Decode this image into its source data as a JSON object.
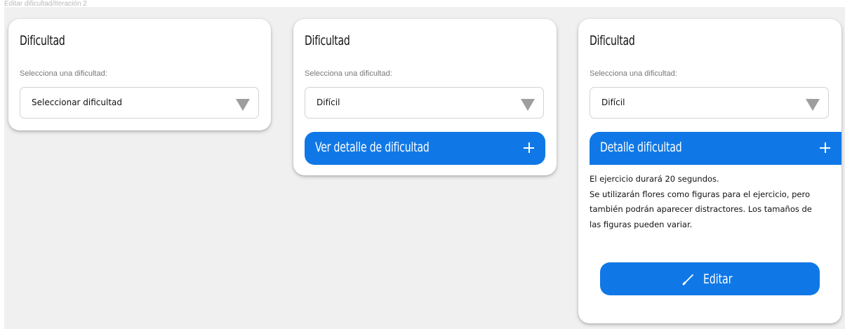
{
  "breadcrumb": "Editar dificultad/Iteración 2",
  "colors": {
    "accent": "#1078e6",
    "background": "#f0f0f0",
    "card": "#ffffff"
  },
  "panels": [
    {
      "title": "Dificultad",
      "select_label": "Selecciona una dificultad:",
      "select_value": "Seleccionar dificultad",
      "arrow_icon": "triangle-down-icon"
    },
    {
      "title": "Dificultad",
      "select_label": "Selecciona una dificultad:",
      "select_value": "Difícil",
      "arrow_icon": "triangle-down-icon",
      "button_label": "Ver detalle de dificultad",
      "button_icon": "plus-icon"
    },
    {
      "title": "Dificultad",
      "select_label": "Selecciona una dificultad:",
      "select_value": "Difícil",
      "arrow_icon": "triangle-down-icon",
      "detail_title": "Detalle dificultad",
      "detail_icon": "plus-icon",
      "detail_lines": [
        "El ejercicio durará 20 segundos.",
        "Se utilizarán flores como figuras para el ejercicio, pero también podrán aparecer distractores. Los tamaños de las figuras pueden variar."
      ],
      "edit_label": "Editar",
      "edit_icon": "pencil-icon"
    }
  ]
}
